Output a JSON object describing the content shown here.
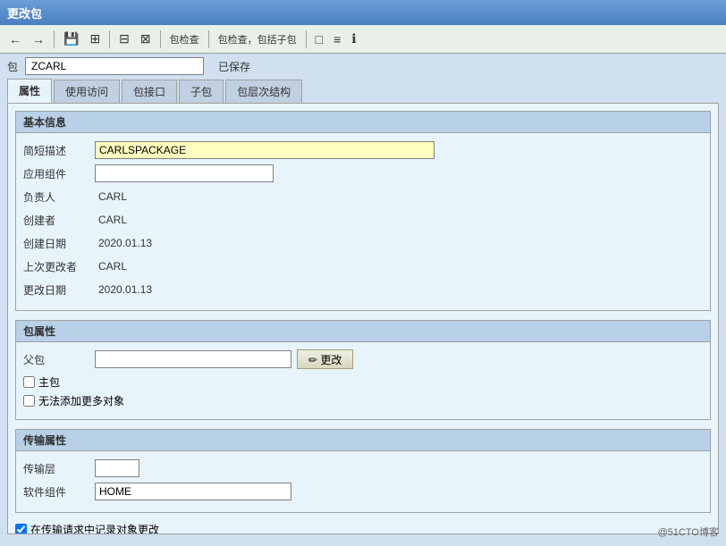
{
  "title_bar": {
    "title": "更改包"
  },
  "toolbar": {
    "back_label": "←",
    "forward_label": "→",
    "icon1": "↩",
    "icon2": "⊞",
    "icon3": "⊟",
    "icon4": "⊠",
    "check_label": "包检查",
    "check_with_sub_label": "包检查，包括子包",
    "icon5": "□",
    "icon6": "≡",
    "icon7": "ℹ"
  },
  "header": {
    "label": "包",
    "value": "ZCARL",
    "status": "已保存"
  },
  "tabs": [
    {
      "label": "属性",
      "active": true
    },
    {
      "label": "使用访问"
    },
    {
      "label": "包接口"
    },
    {
      "label": "子包"
    },
    {
      "label": "包层次结构"
    }
  ],
  "basic_info": {
    "section_title": "基本信息",
    "fields": [
      {
        "label": "简短描述",
        "value": "CARLSPACKAGE",
        "type": "highlight"
      },
      {
        "label": "应用组件",
        "value": "",
        "type": "plain-medium"
      },
      {
        "label": "负责人",
        "value": "CARL",
        "type": "text-box"
      },
      {
        "label": "创建者",
        "value": "CARL",
        "type": "text-box"
      },
      {
        "label": "创建日期",
        "value": "2020.01.13",
        "type": "text-box"
      },
      {
        "label": "上次更改者",
        "value": "CARL",
        "type": "text-box"
      },
      {
        "label": "更改日期",
        "value": "2020.01.13",
        "type": "text-box"
      }
    ]
  },
  "package_props": {
    "section_title": "包属性",
    "parent_label": "父包",
    "parent_value": "",
    "change_btn": "更改",
    "main_pkg_label": "主包",
    "no_add_label": "无法添加更多对象"
  },
  "transfer_props": {
    "section_title": "传输属性",
    "layer_label": "传输层",
    "layer_value": "",
    "software_label": "软件组件",
    "software_value": "HOME"
  },
  "bottom_note": {
    "checkbox_label": "在传输请求中记录对象更改"
  },
  "watermark": "@51CTO博客"
}
